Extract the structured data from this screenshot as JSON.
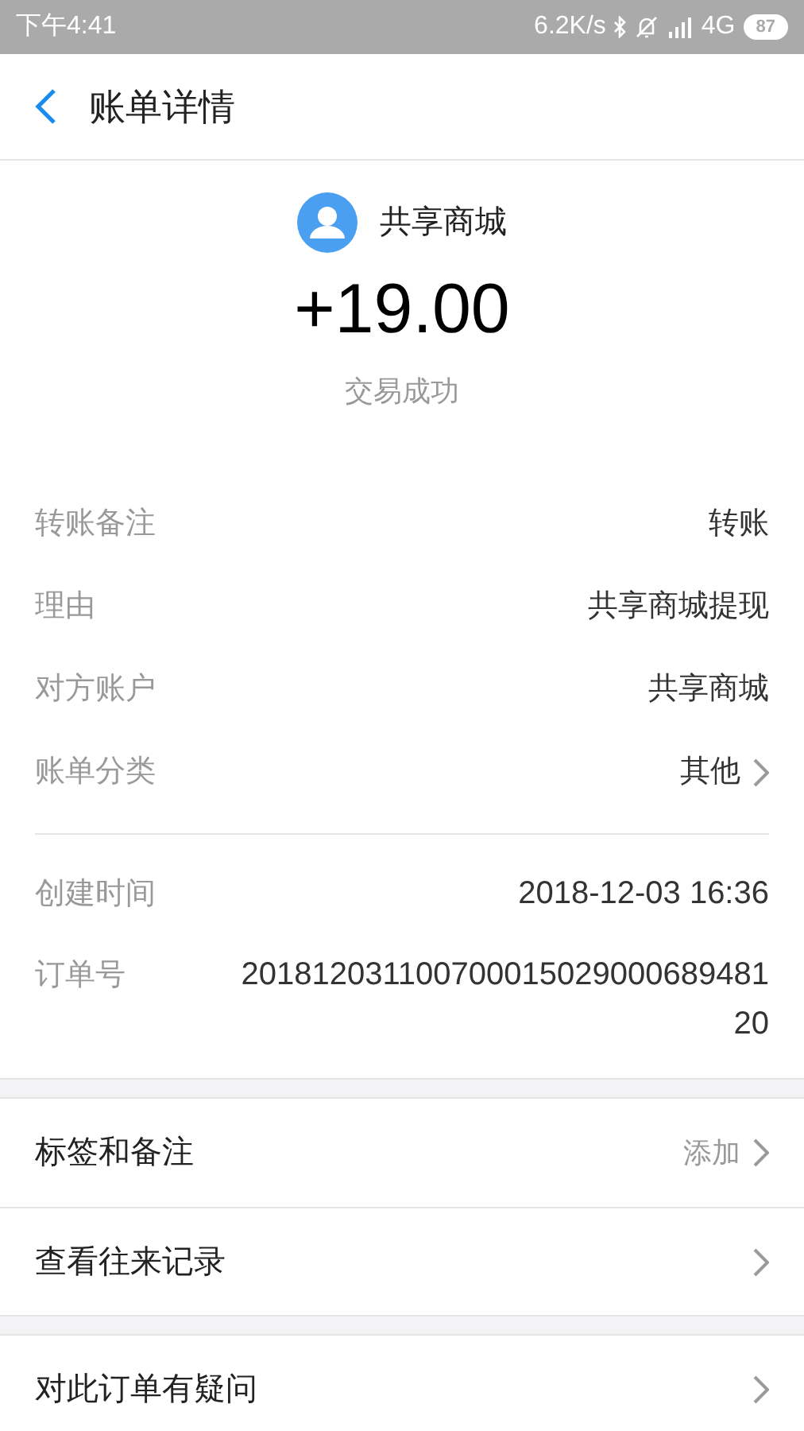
{
  "status_bar": {
    "time": "下午4:41",
    "speed": "6.2K/s",
    "network": "4G",
    "battery": "87"
  },
  "header": {
    "title": "账单详情"
  },
  "summary": {
    "name": "共享商城",
    "amount": "+19.00",
    "status": "交易成功"
  },
  "details": [
    {
      "label": "转账备注",
      "value": "转账",
      "chevron": false
    },
    {
      "label": "理由",
      "value": "共享商城提现",
      "chevron": false
    },
    {
      "label": "对方账户",
      "value": "共享商城",
      "chevron": false
    },
    {
      "label": "账单分类",
      "value": "其他",
      "chevron": true
    }
  ],
  "info": [
    {
      "label": "创建时间",
      "value": "2018-12-03 16:36"
    },
    {
      "label": "订单号",
      "value": "20181203110070001502900068948120"
    }
  ],
  "actions": [
    [
      {
        "label": "标签和备注",
        "hint": "添加"
      },
      {
        "label": "查看往来记录"
      }
    ],
    [
      {
        "label": "对此订单有疑问"
      }
    ]
  ]
}
